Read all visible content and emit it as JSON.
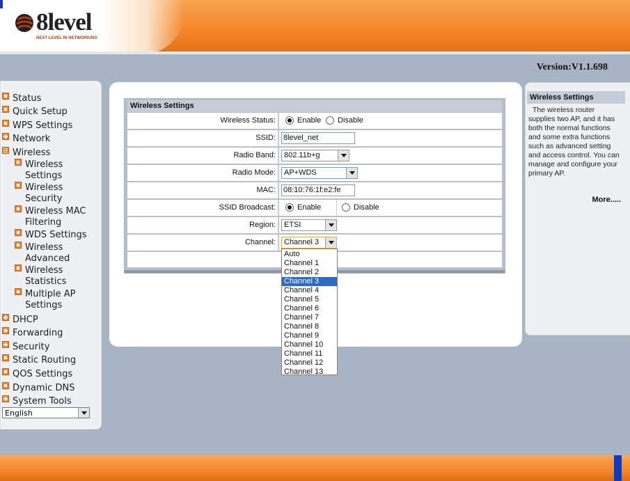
{
  "header": {
    "brand": "8level",
    "tagline": "NEXT LEVEL IN NETWORKING",
    "version": "Version:V1.1.698"
  },
  "sidebar": {
    "items": [
      {
        "label": "Status",
        "icon": "square-icon"
      },
      {
        "label": "Quick Setup",
        "icon": "square-icon"
      },
      {
        "label": "WPS Settings",
        "icon": "square-icon"
      },
      {
        "label": "Network",
        "icon": "plus-icon"
      },
      {
        "label": "Wireless",
        "icon": "minus-icon"
      },
      {
        "label": "DHCP",
        "icon": "plus-icon"
      },
      {
        "label": "Forwarding",
        "icon": "plus-icon"
      },
      {
        "label": "Security",
        "icon": "plus-icon"
      },
      {
        "label": "Static Routing",
        "icon": "square-icon"
      },
      {
        "label": "QOS Settings",
        "icon": "square-icon"
      },
      {
        "label": "Dynamic DNS",
        "icon": "square-icon"
      },
      {
        "label": "System Tools",
        "icon": "plus-icon"
      }
    ],
    "wireless_sub": [
      {
        "line1": "Wireless",
        "line2": "Settings",
        "icon": "arrow-icon"
      },
      {
        "line1": "Wireless",
        "line2": "Security",
        "icon": "square-icon"
      },
      {
        "line1": "Wireless MAC",
        "line2": "Filtering",
        "icon": "square-icon"
      },
      {
        "line1": "WDS Settings",
        "line2": "",
        "icon": "square-icon"
      },
      {
        "line1": "Wireless",
        "line2": "Advanced",
        "icon": "square-icon"
      },
      {
        "line1": "Wireless",
        "line2": "Statistics",
        "icon": "square-icon"
      },
      {
        "line1": "Multiple AP",
        "line2": "Settings",
        "icon": "square-icon"
      }
    ],
    "language": "English"
  },
  "form": {
    "title": "Wireless Settings",
    "wireless_status": {
      "label": "Wireless Status:",
      "enable": "Enable",
      "disable": "Disable",
      "selected": "Enable"
    },
    "ssid": {
      "label": "SSID:",
      "value": "8level_net"
    },
    "radio_band": {
      "label": "Radio Band:",
      "value": "802.11b+g"
    },
    "radio_mode": {
      "label": "Radio Mode:",
      "value": "AP+WDS"
    },
    "mac": {
      "label": "MAC:",
      "value": "08:10:76:1f:e2:fe"
    },
    "ssid_broadcast": {
      "label": "SSID Broadcast:",
      "enable": "Enable",
      "disable": "Disable",
      "selected": "Enable"
    },
    "region": {
      "label": "Region:",
      "value": "ETSI"
    },
    "channel": {
      "label": "Channel:",
      "value": "Channel 3"
    }
  },
  "channel_options": [
    "Auto",
    "Channel 1",
    "Channel 2",
    "Channel 3",
    "Channel 4",
    "Channel 5",
    "Channel 6",
    "Channel 7",
    "Channel 8",
    "Channel 9",
    "Channel 10",
    "Channel 11",
    "Channel 12",
    "Channel 13"
  ],
  "help": {
    "title": "Wireless Settings",
    "body": "The wireless router supplies two AP, and it has both the normal functions and some extra functions such as advanced setting and access control. You can manage and configure your primary AP.",
    "more": "More....."
  },
  "colors": {
    "accent": "#f5862a",
    "selected": "#316ac5",
    "blue_bar": "#1538b5"
  }
}
